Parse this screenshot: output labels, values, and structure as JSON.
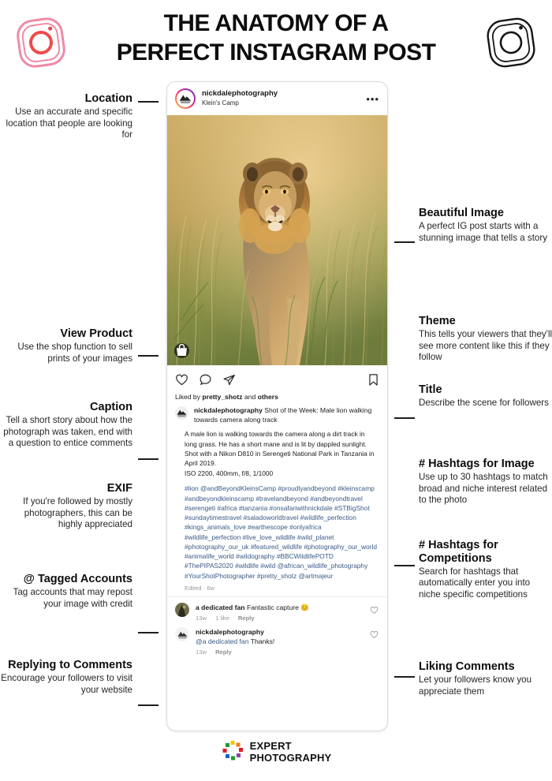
{
  "header": {
    "title_line1": "THE ANATOMY OF A",
    "title_line2": "PERFECT INSTAGRAM POST",
    "logo_left": "instagram-logo-pink",
    "logo_right": "instagram-logo-black"
  },
  "post": {
    "username": "nickdalephotography",
    "location": "Klein's Camp",
    "more_options": "•••",
    "photo_alt": "lion-walking-towards-camera-photo",
    "shop_icon": "shopping-bag-icon",
    "actions": {
      "like": "heart-icon",
      "comment": "comment-bubble-icon",
      "share": "paper-plane-icon",
      "save": "bookmark-icon"
    },
    "likes_prefix": "Liked by ",
    "likes_user": "pretty_shotz",
    "likes_suffix": " and ",
    "likes_others": "others",
    "caption_user": "nickdalephotography",
    "caption_title": "Shot of the Week: Male lion walking towards camera along track",
    "caption_body": "A male lion is walking towards the camera along a dirt track in long grass. He has a short mane and is lit by dappled sunlight. Shot with a Nikon D810 in Serengeti National Park in Tanzania in April 2019.",
    "caption_exif": "ISO 2200, 400mm, f/8, 1/1000",
    "hashtags": "#lion @andBeyondKleinsCamp #proudlyandbeyond #kleinscamp #andbeyondkleinscamp #travelandbeyond #andbeyondtravel #serengeti #africa #tanzania #onsafariwithnickdale #STBigShot #sundaytimestravel #saladoworldtravel #wildlife_perfection #kings_animals_love #earthescope #onlyafrica #wildlife_perfection #live_love_wildlife #wild_planet #photography_our_uk #featured_wildlife #photography_our_world #animalife_world #wildography #BBCWildlifePOTD #ThePIPAS2020 #wildlife #wild @african_wildlife_photography #YourShotPhotographer #pretty_shotz @artmajeur",
    "edited": "Edited · 6w",
    "comments": [
      {
        "avatar": "dedicated-fan-avatar",
        "user": "a dedicated fan",
        "text": "Fantastic capture ",
        "emoji": "😊",
        "time": "13w",
        "likes": "1 like",
        "reply": "Reply",
        "heart": "heart-outline-icon"
      },
      {
        "avatar": "nickdalephotography-avatar",
        "user": "nickdalephotography",
        "mention": "@a dedicated fan",
        "text": " Thanks!",
        "time": "13w",
        "reply": "Reply",
        "heart": "heart-outline-icon"
      }
    ]
  },
  "annotations_left": [
    {
      "title": "Location",
      "text": "Use an accurate and specific location that people are looking for"
    },
    {
      "title": "View Product",
      "text": "Use the shop function to sell prints of your images"
    },
    {
      "title": "Caption",
      "text": "Tell a short story about how the photograph was taken, end with a question to entice comments"
    },
    {
      "title": "EXIF",
      "text": "If you're followed by mostly photographers, this can be highly appreciated"
    },
    {
      "title": "@ Tagged Accounts",
      "text": "Tag accounts that may repost your image with credit"
    },
    {
      "title": "Replying to Comments",
      "text": "Encourage your followers to visit your website"
    }
  ],
  "annotations_right": [
    {
      "title": "Beautiful Image",
      "text": "A perfect IG post starts with a stunning image that tells a story"
    },
    {
      "title": "Theme",
      "text": "This tells your viewers that they'll see more content like this if they follow"
    },
    {
      "title": "Title",
      "text": "Describe the scene for followers"
    },
    {
      "title": "# Hashtags for Image",
      "text": "Use up to 30 hashtags to match broad and niche interest related to the photo"
    },
    {
      "title": "# Hashtags for Competitions",
      "text": "Search for hashtags that automatically enter you into niche specific competitions"
    },
    {
      "title": "Liking Comments",
      "text": "Let your followers know you appreciate them"
    }
  ],
  "footer": {
    "logo": "expert-photography-color-wheel-logo",
    "line1": "EXPERT",
    "line2": "PHOTOGRAPHY"
  },
  "colors": {
    "accent_pink": "#ee2a7b",
    "link_blue": "#3a5a86",
    "text_dark": "#1a1a1a",
    "muted": "#9a9a9a"
  }
}
